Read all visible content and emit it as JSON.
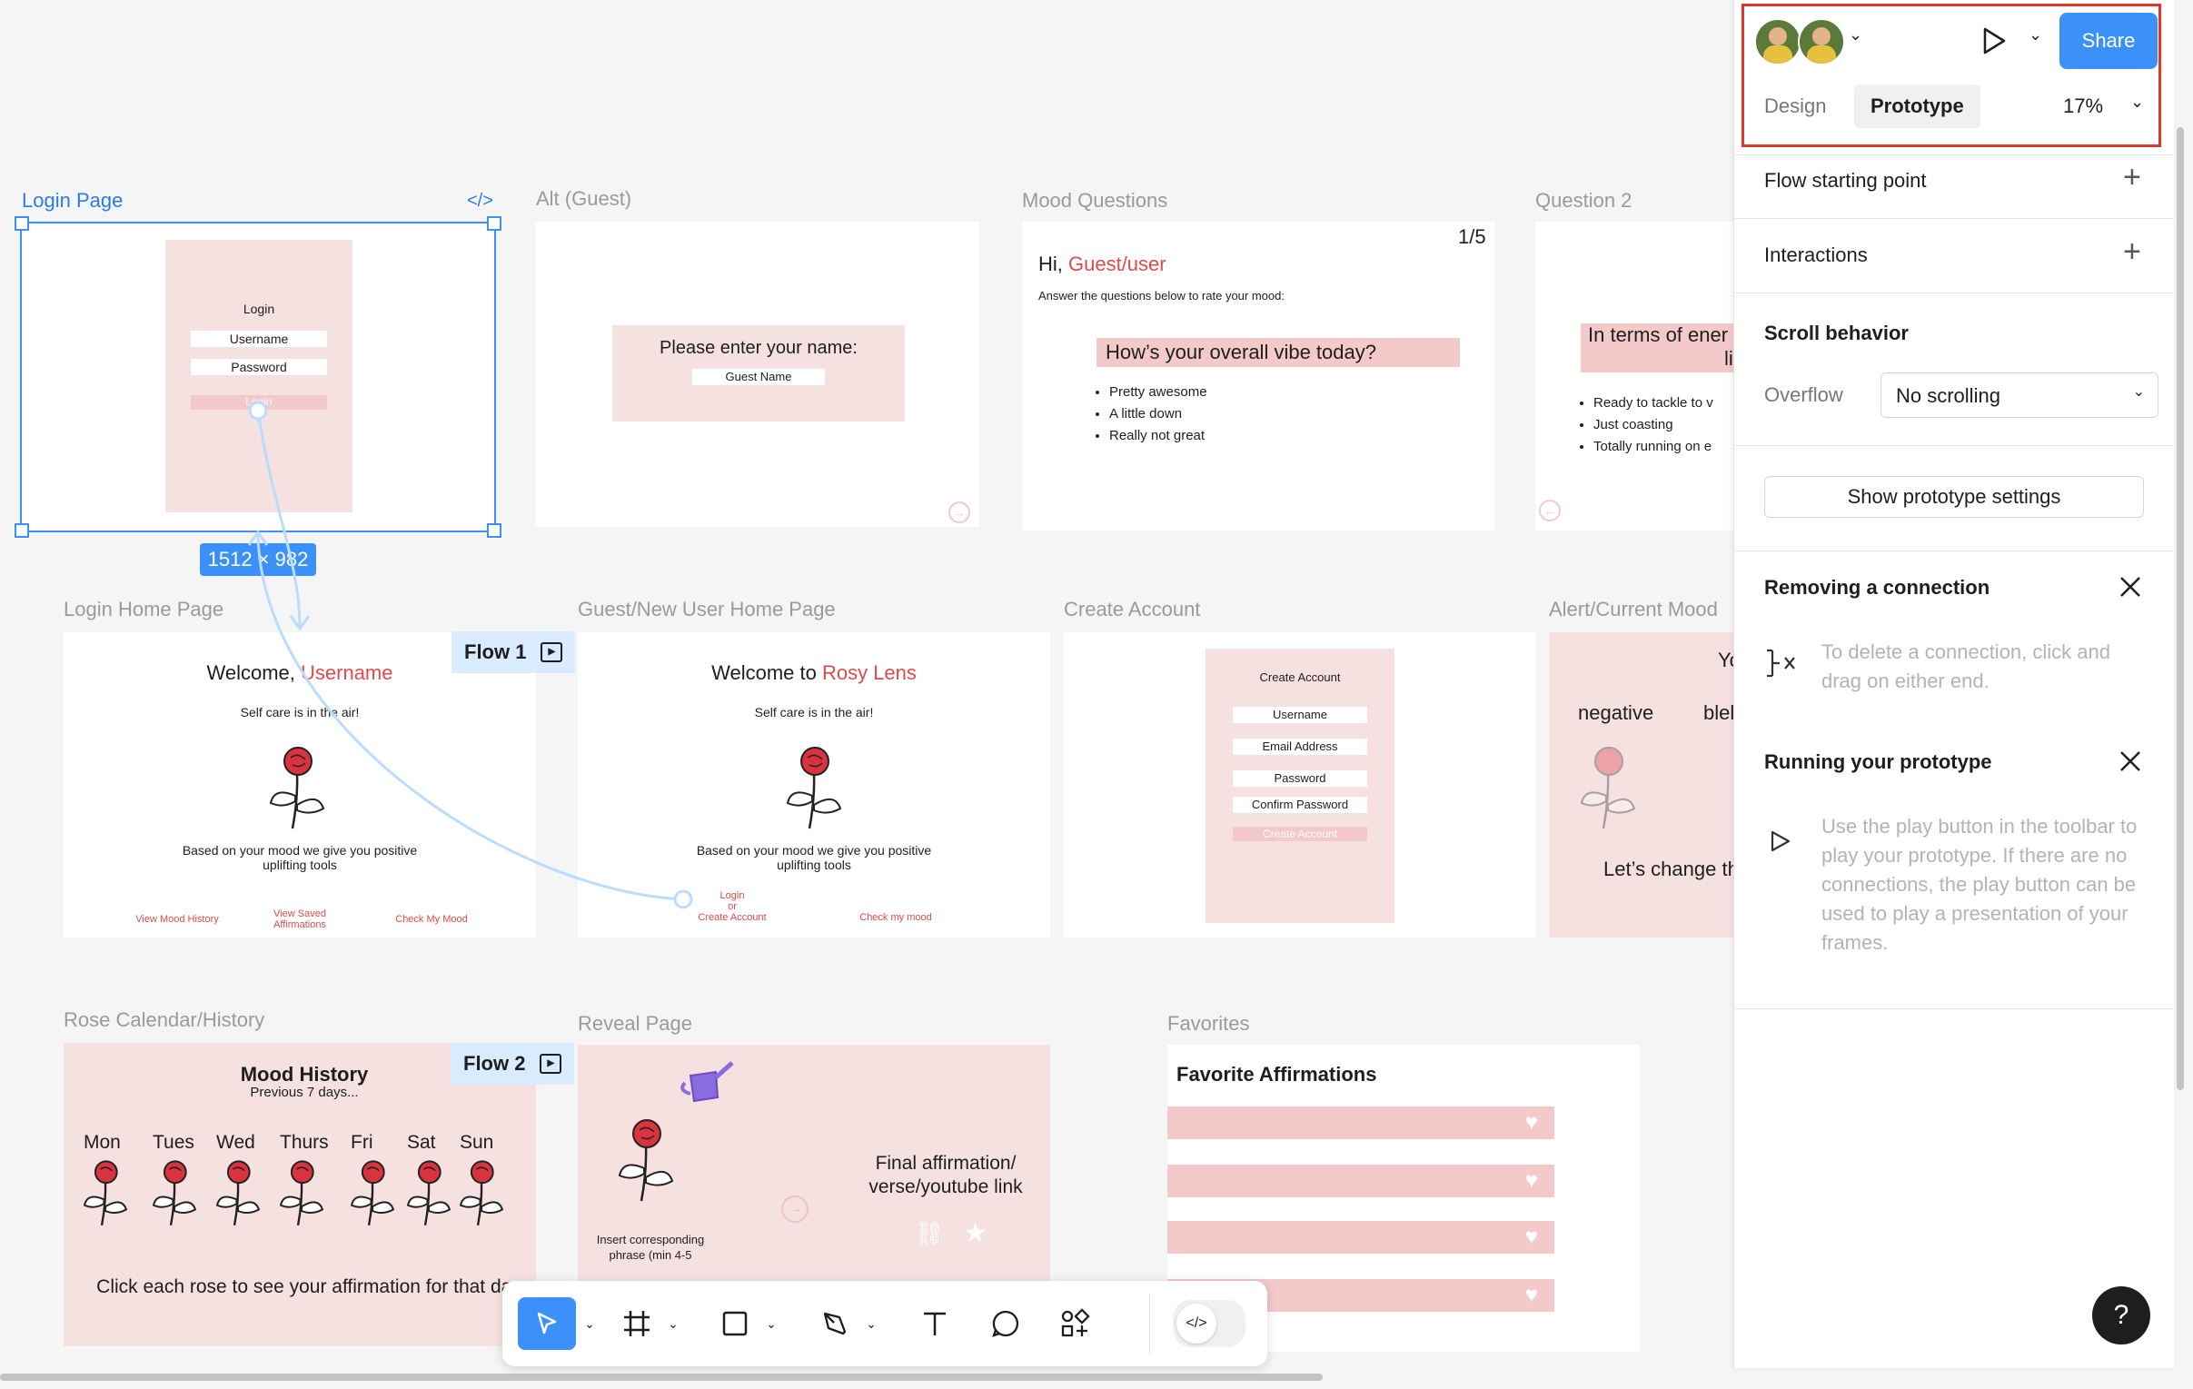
{
  "canvas": {
    "frames": {
      "login": {
        "label": "Login Page",
        "title": "Login",
        "username": "Username",
        "password": "Password",
        "button": "Login",
        "size_badge": "1512 × 982"
      },
      "alt_guest": {
        "label": "Alt (Guest)",
        "prompt": "Please enter your name:",
        "field": "Guest Name"
      },
      "mood_questions": {
        "label": "Mood Questions",
        "counter": "1/5",
        "greeting_prefix": "Hi, ",
        "greeting_name": "Guest/user",
        "instructions": "Answer the questions below to rate your mood:",
        "question": "How’s your overall vibe today?",
        "options": [
          "Pretty awesome",
          "A little down",
          "Really not great"
        ]
      },
      "question2": {
        "label": "Question 2",
        "question": "In terms of ener",
        "question_line2": "lik",
        "options": [
          "Ready to tackle to v",
          "Just coasting",
          "Totally running on e"
        ]
      },
      "login_home": {
        "label": "Login Home Page",
        "welcome_prefix": "Welcome, ",
        "welcome_name": "Username",
        "subtitle": "Self care is in the air!",
        "body": "Based on your mood we give you positive uplifting tools",
        "links": [
          "View Mood History",
          "View Saved Affirmations",
          "Check My Mood"
        ]
      },
      "guest_home": {
        "label": "Guest/New User Home Page",
        "welcome_prefix": "Welcome to ",
        "welcome_name": "Rosy Lens",
        "subtitle": "Self care is in the air!",
        "body": "Based on your mood we give you positive uplifting tools",
        "link_login": "Login",
        "link_or": "or",
        "link_create": "Create Account",
        "link_check": "Check my mood"
      },
      "create_account": {
        "label": "Create Account",
        "title": "Create Account",
        "fields": [
          "Username",
          "Email Address",
          "Password",
          "Confirm Password"
        ],
        "button": "Create Account"
      },
      "alert": {
        "label": "Alert/Current Mood",
        "top": "Yo",
        "left": "negative",
        "right": "blel",
        "bottom": "Let’s change th"
      },
      "rose_calendar": {
        "label": "Rose Calendar/History",
        "title": "Mood History",
        "subtitle": "Previous 7 days...",
        "days": [
          "Mon",
          "Tues",
          "Wed",
          "Thurs",
          "Fri",
          "Sat",
          "Sun"
        ],
        "footer": "Click each rose to see your affirmation for that day"
      },
      "reveal": {
        "label": "Reveal Page",
        "final": "Final affirmation/ verse/youtube link",
        "insert": "Insert corresponding phrase (min 4-5"
      },
      "favorites": {
        "label": "Favorites",
        "title": "Favorite Affirmations"
      }
    },
    "flows": [
      "Flow 1",
      "Flow 2"
    ]
  },
  "toolbar": {
    "tools": [
      "move-tool",
      "frame-tool",
      "rectangle-tool",
      "pen-tool",
      "text-tool",
      "comment-tool",
      "actions-tool",
      "dev-mode-toggle"
    ]
  },
  "panel": {
    "share": "Share",
    "tabs": [
      "Design",
      "Prototype"
    ],
    "zoom": "17%",
    "flow_starting_point": "Flow starting point",
    "interactions": "Interactions",
    "scroll_behavior": "Scroll behavior",
    "overflow_label": "Overflow",
    "overflow_value": "No scrolling",
    "prototype_settings": "Show prototype settings",
    "removing_title": "Removing a connection",
    "removing_text": "To delete a connection, click and drag on either end.",
    "running_title": "Running your prototype",
    "running_text": "Use the play button in the toolbar to play your prototype. If there are no connections, the play button can be used to play a presentation of your frames.",
    "help": "?"
  },
  "colors": {
    "accent": "#3b91f7",
    "pink": "#f6e1e1",
    "rose_red": "#e04a4a",
    "highlight_box": "#e0372d"
  }
}
